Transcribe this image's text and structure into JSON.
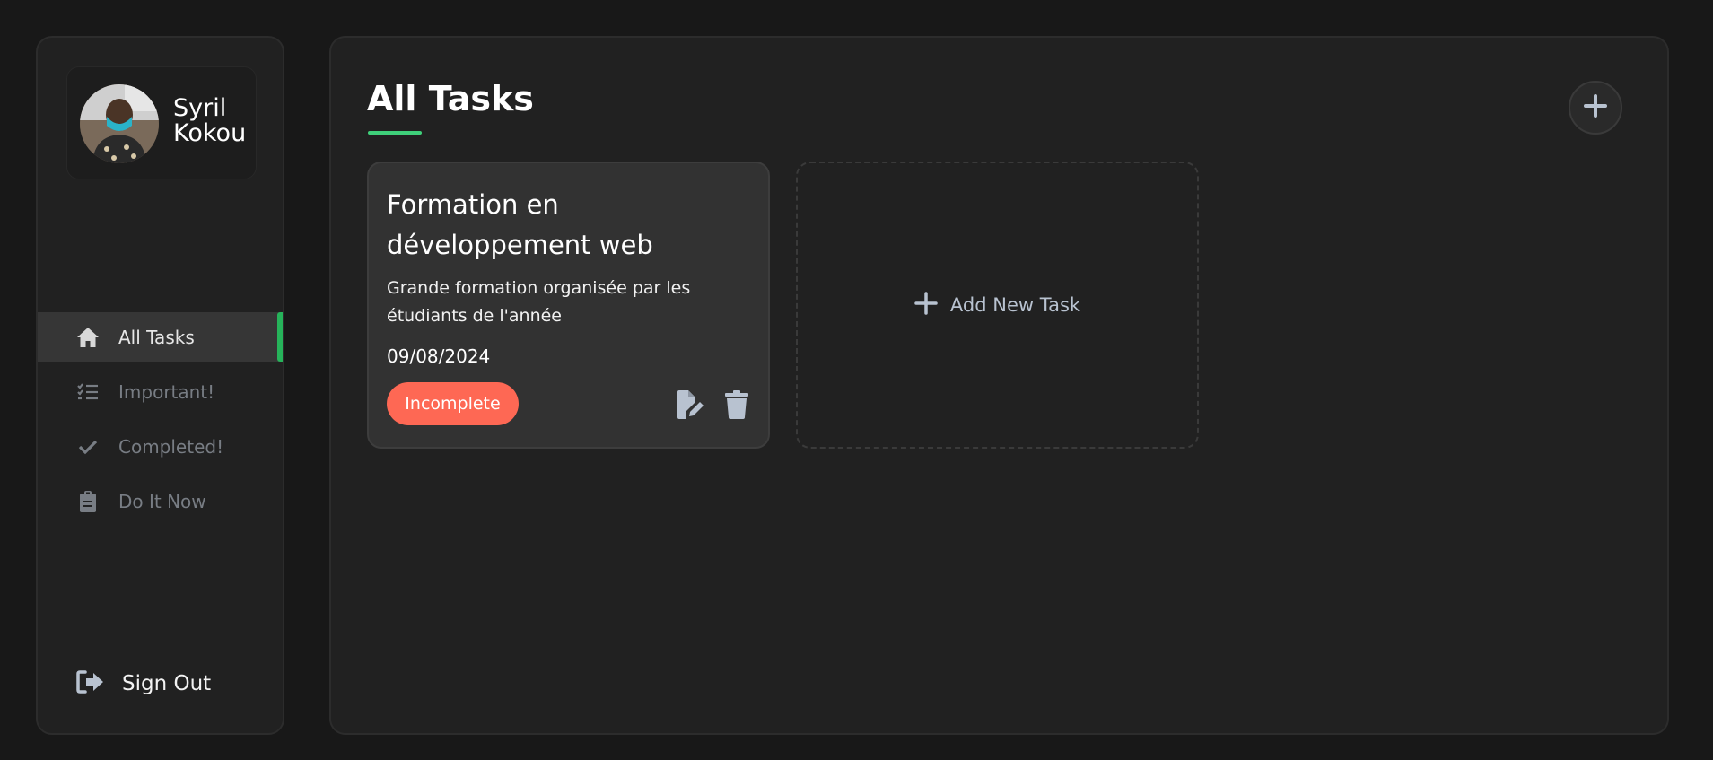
{
  "user": {
    "name": "Syril Kokou"
  },
  "sidebar": {
    "items": [
      {
        "label": "All Tasks",
        "icon": "home-icon",
        "active": true
      },
      {
        "label": "Important!",
        "icon": "checklist-icon",
        "active": false
      },
      {
        "label": "Completed!",
        "icon": "check-icon",
        "active": false
      },
      {
        "label": "Do It Now",
        "icon": "clipboard-icon",
        "active": false
      }
    ],
    "signout_label": "Sign Out"
  },
  "main": {
    "title": "All Tasks",
    "tasks": [
      {
        "title": "Formation en développement web",
        "description": "Grande formation organisée par les étudiants de l'année",
        "date": "09/08/2024",
        "status": "Incomplete"
      }
    ],
    "add_task_label": "Add New Task"
  },
  "colors": {
    "accent_green": "#3fd07a",
    "incomplete_red": "#fe6854",
    "background": "#181818",
    "panel": "#212121",
    "card": "#323232"
  }
}
